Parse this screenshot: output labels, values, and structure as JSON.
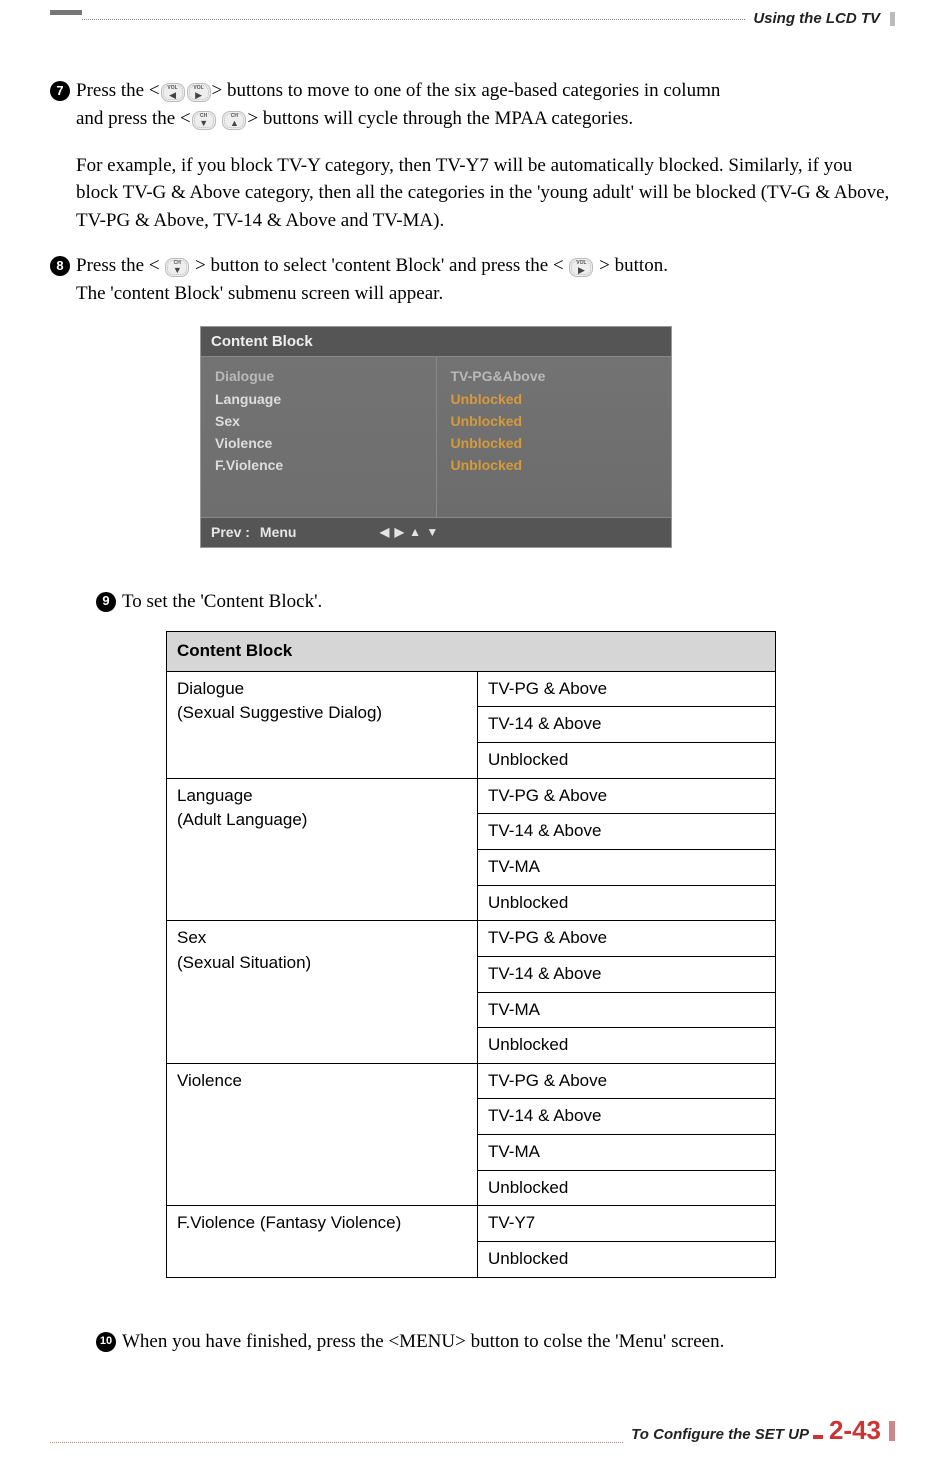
{
  "header": {
    "title": "Using the LCD TV"
  },
  "buttons": {
    "vol_left_label": "VOL",
    "vol_left_arrow": "◀",
    "vol_right_label": "VOL",
    "vol_right_arrow": "▶",
    "ch_down_label": "CH",
    "ch_down_arrow": "▼",
    "ch_up_label": "CH",
    "ch_up_arrow": "▲"
  },
  "step7": {
    "line1a": "Press the <",
    "line1b": "> buttons to move to one of the six age-based categories in column",
    "line2a": "and press the <",
    "line2b": "> buttons will cycle through the MPAA categories.",
    "para": "For example, if you block TV-Y category, then TV-Y7 will be automatically blocked. Similarly, if you block TV-G & Above category, then all the categories in the 'young adult' will be blocked (TV-G & Above, TV-PG & Above, TV-14 & Above and TV-MA)."
  },
  "step8": {
    "line1a": "Press the <",
    "line1b": "> button to select 'content Block' and press the <",
    "line1c": "> button.",
    "line2": "The 'content Block' submenu screen will appear."
  },
  "menu": {
    "title": "Content Block",
    "left": [
      "Dialogue",
      "Language",
      "Sex",
      "Violence",
      "F.Violence"
    ],
    "right_top": "TV-PG&Above",
    "right_rest": [
      "Unblocked",
      "Unblocked",
      "Unblocked",
      "Unblocked"
    ],
    "footer_prev": "Prev :",
    "footer_menu": "Menu",
    "footer_arrows": "◀ ▶ ▲ ▼"
  },
  "step9": {
    "text": "To set the 'Content Block'."
  },
  "table": {
    "header": "Content Block",
    "rows": [
      {
        "label": "Dialogue\n(Sexual Suggestive Dialog)",
        "opts": [
          "TV-PG & Above",
          "TV-14 & Above",
          "Unblocked"
        ]
      },
      {
        "label": "Language\n(Adult Language)",
        "opts": [
          "TV-PG & Above",
          "TV-14 & Above",
          "TV-MA",
          "Unblocked"
        ]
      },
      {
        "label": "Sex\n(Sexual Situation)",
        "opts": [
          "TV-PG & Above",
          "TV-14 & Above",
          "TV-MA",
          "Unblocked"
        ]
      },
      {
        "label": "Violence",
        "opts": [
          "TV-PG & Above",
          "TV-14 & Above",
          "TV-MA",
          "Unblocked"
        ]
      },
      {
        "label": "F.Violence (Fantasy Violence)",
        "opts": [
          "TV-Y7",
          "Unblocked"
        ]
      }
    ]
  },
  "step10": {
    "text": "When you have finished, press the <MENU> button to colse the 'Menu' screen."
  },
  "footer": {
    "text": "To Configure the SET UP",
    "page": "2-43"
  }
}
